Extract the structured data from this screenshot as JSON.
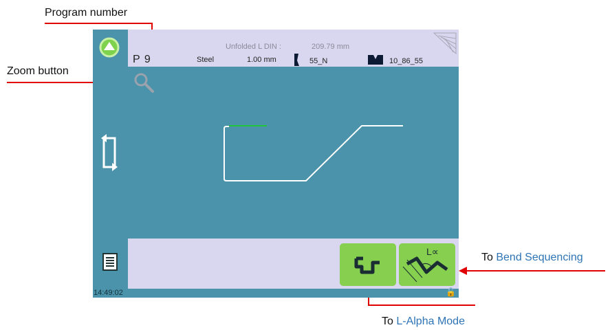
{
  "annotations": {
    "program_number": "Program number",
    "zoom_button": "Zoom button",
    "bend_sequencing_prefix": "To ",
    "bend_sequencing_link": "Bend Sequencing",
    "l_alpha_prefix": "To ",
    "l_alpha_link": "L-Alpha Mode"
  },
  "header": {
    "program": "P 9",
    "unfolded_label": "Unfolded  L  DIN :",
    "unfolded_value": "209.79 mm",
    "material": "Steel",
    "thickness": "1.00 mm",
    "punch": "55_N",
    "die": "10_86_55"
  },
  "status": {
    "time": "14:49:02"
  },
  "bend_buttons": {
    "l_alpha_label": "L∝"
  },
  "colors": {
    "panel": "#4a93ab",
    "background": "#d9d6ef",
    "button": "#86cf4f",
    "annotation_arrow": "#e00000",
    "highlight_edge": "#22c43a"
  }
}
